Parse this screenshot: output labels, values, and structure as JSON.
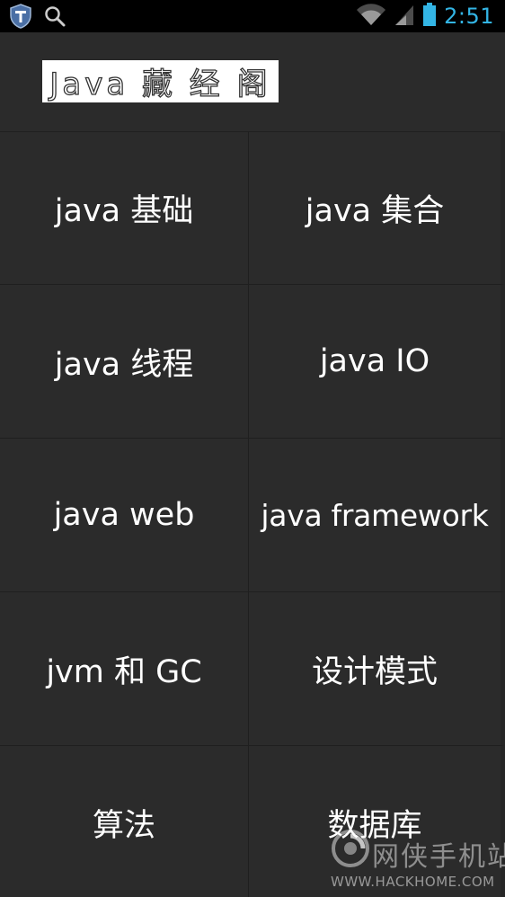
{
  "status_bar": {
    "left_icons": [
      "shield-icon",
      "search-icon"
    ],
    "right_icons": [
      "wifi-icon",
      "signal-icon",
      "battery-icon"
    ],
    "time": "2:51",
    "time_color": "#33b5e5"
  },
  "header": {
    "logo_text": "Java 藏 经 阁"
  },
  "menu": {
    "items": [
      {
        "label": "java 基础"
      },
      {
        "label": "java 集合"
      },
      {
        "label": "java 线程"
      },
      {
        "label": "java IO"
      },
      {
        "label": "java web"
      },
      {
        "label": "java framework"
      },
      {
        "label": "jvm 和 GC"
      },
      {
        "label": "设计模式"
      },
      {
        "label": "算法"
      },
      {
        "label": "数据库"
      }
    ]
  },
  "watermark": {
    "cn": "网侠手机站",
    "en": "WWW.HACKHOME.COM"
  },
  "colors": {
    "background": "#2b2b2b",
    "status_bar": "#000000",
    "accent": "#33b5e5",
    "text": "#ffffff"
  }
}
